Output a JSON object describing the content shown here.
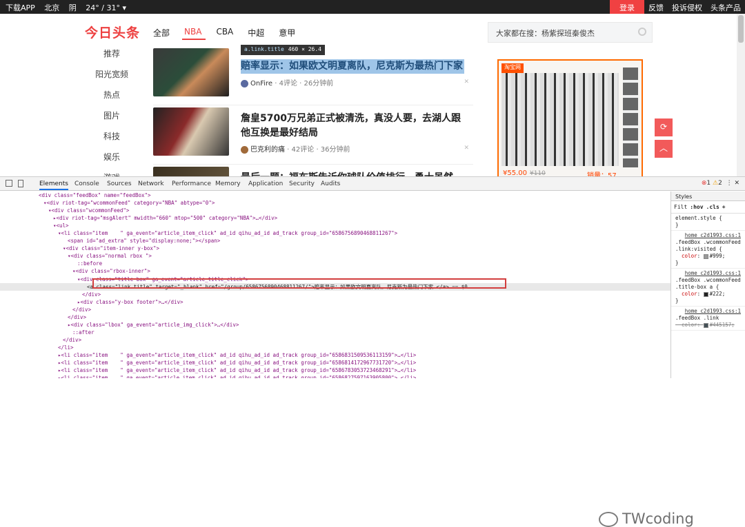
{
  "topbar": {
    "download": "下载APP",
    "city": "北京",
    "weather": "阴",
    "temp": "24° / 31° ▾",
    "login": "登录",
    "links": [
      "反馈",
      "投诉侵权",
      "头条产品"
    ]
  },
  "logo": "今日头条",
  "nav_tabs": [
    "全部",
    "NBA",
    "CBA",
    "中超",
    "意甲"
  ],
  "search": {
    "placeholder": "大家都在搜：杨紫探班秦俊杰"
  },
  "sidebar": [
    "推荐",
    "阳光宽频",
    "热点",
    "图片",
    "科技",
    "娱乐",
    "游戏"
  ],
  "tooltip": {
    "selector": "a.link.title",
    "size": "460 × 26.4"
  },
  "feed": [
    {
      "title": "赔率显示：如果欧文明夏离队，尼克斯为最热门下家",
      "source": "OnFire",
      "meta": " · 4评论 · 26分钟前"
    },
    {
      "title": "詹皇5700万兄弟正式被清洗，真没人要，去湖人跟他互换是最好结局",
      "source": "巴克利的痛",
      "meta": " · 42评论 · 36分钟前"
    },
    {
      "title": "最后一题：福布斯告诉你球队价值排行，勇士虽然"
    }
  ],
  "ad": {
    "store": "淘宝网",
    "price": "¥55.00",
    "orig_price": "¥110",
    "sales": "销量：57"
  },
  "devtools": {
    "tabs": [
      "Elements",
      "Console",
      "Sources",
      "Network",
      "Performance",
      "Memory",
      "Application",
      "Security",
      "Audits"
    ],
    "errors": "1",
    "warnings": "2",
    "styles_tab": "Styles",
    "filter": "Filt",
    "hov": ":hov",
    "cls": ".cls",
    "element_style": "element.style {",
    "close_brace": "}",
    "rule1_src": "home_c2d1993.css:1",
    "rule1_sel": ".feedBox .wcommonFeed .link:visited {",
    "rule1_prop": "color",
    "rule1_val": "#999;",
    "rule2_src": "home_c2d1993.css:1",
    "rule2_sel": ".feedBox .wcommonFeed .title-box a {",
    "rule2_prop": "color",
    "rule2_val": "#222;",
    "rule3_src": "home_c2d1993.css:1",
    "rule3_sel": ".feedBox .link",
    "rule3_prop": "color",
    "rule3_val": "#445157;"
  },
  "dom_lines": [
    {
      "i": 8,
      "t": "<div class=\"feedBox\" name=\"feedBox\">"
    },
    {
      "i": 9,
      "t": "▾<div riot-tag=\"wcommonFeed\" category=\"NBA\" abtype=\"0\">"
    },
    {
      "i": 10,
      "t": "▾<div class=\"wcommonFeed\">"
    },
    {
      "i": 11,
      "t": "▸<div riot-tag=\"msgAlert\" mwidth=\"660\" mtop=\"500\" category=\"NBA\">…</div>"
    },
    {
      "i": 11,
      "t": "▾<ul>"
    },
    {
      "i": 12,
      "t": "▾<li class=\"item    \" ga_event=\"article_item_click\" ad_id qihu_ad_id ad_track group_id=\"6586756890468811267\">"
    },
    {
      "i": 14,
      "t": "<span id=\"ad_extra\" style=\"display:none;\"></span>"
    },
    {
      "i": 13,
      "t": "▾<div class=\"item-inner y-box\">"
    },
    {
      "i": 14,
      "t": "▾<div class=\"normal rbox \">"
    },
    {
      "i": 16,
      "t": "::before"
    },
    {
      "i": 15,
      "t": "▾<div class=\"rbox-inner\">"
    },
    {
      "i": 16,
      "t": "▾<div class=\"title-box\" ga_event=\"article_title_click\">"
    },
    {
      "i": 18,
      "t": "<a class=\"link title\" target=\"_blank\" href=\"/group/6586756890468811267/\">赔率显示：如果欧文明夏离队，尼克斯为最热门下家 </a> == $0",
      "sel": true
    },
    {
      "i": 17,
      "t": "</div>"
    },
    {
      "i": 16,
      "t": "▸<div class=\"y-box footer\">…</div>"
    },
    {
      "i": 15,
      "t": "</div>"
    },
    {
      "i": 14,
      "t": "</div>"
    },
    {
      "i": 14,
      "t": "▸<div class=\"lbox\" ga_event=\"article_img_click\">…</div>"
    },
    {
      "i": 15,
      "t": "::after"
    },
    {
      "i": 13,
      "t": "</div>"
    },
    {
      "i": 12,
      "t": "</li>"
    },
    {
      "i": 12,
      "t": "▸<li class=\"item    \" ga_event=\"article_item_click\" ad_id qihu_ad_id ad_track group_id=\"6586831509536113159\">…</li>"
    },
    {
      "i": 12,
      "t": "▸<li class=\"item    \" ga_event=\"article_item_click\" ad_id qihu_ad_id ad_track group_id=\"6586814172967731720\">…</li>"
    },
    {
      "i": 12,
      "t": "▸<li class=\"item    \" ga_event=\"article_item_click\" ad_id qihu_ad_id ad_track group_id=\"6586783053723468291\">…</li>"
    },
    {
      "i": 12,
      "t": "▸<li class=\"item    \" ga_event=\"article_item_click\" ad_id qihu_ad_id ad_track group_id=\"6586827597163905800\">…</li>"
    }
  ],
  "watermark": "TWcoding"
}
